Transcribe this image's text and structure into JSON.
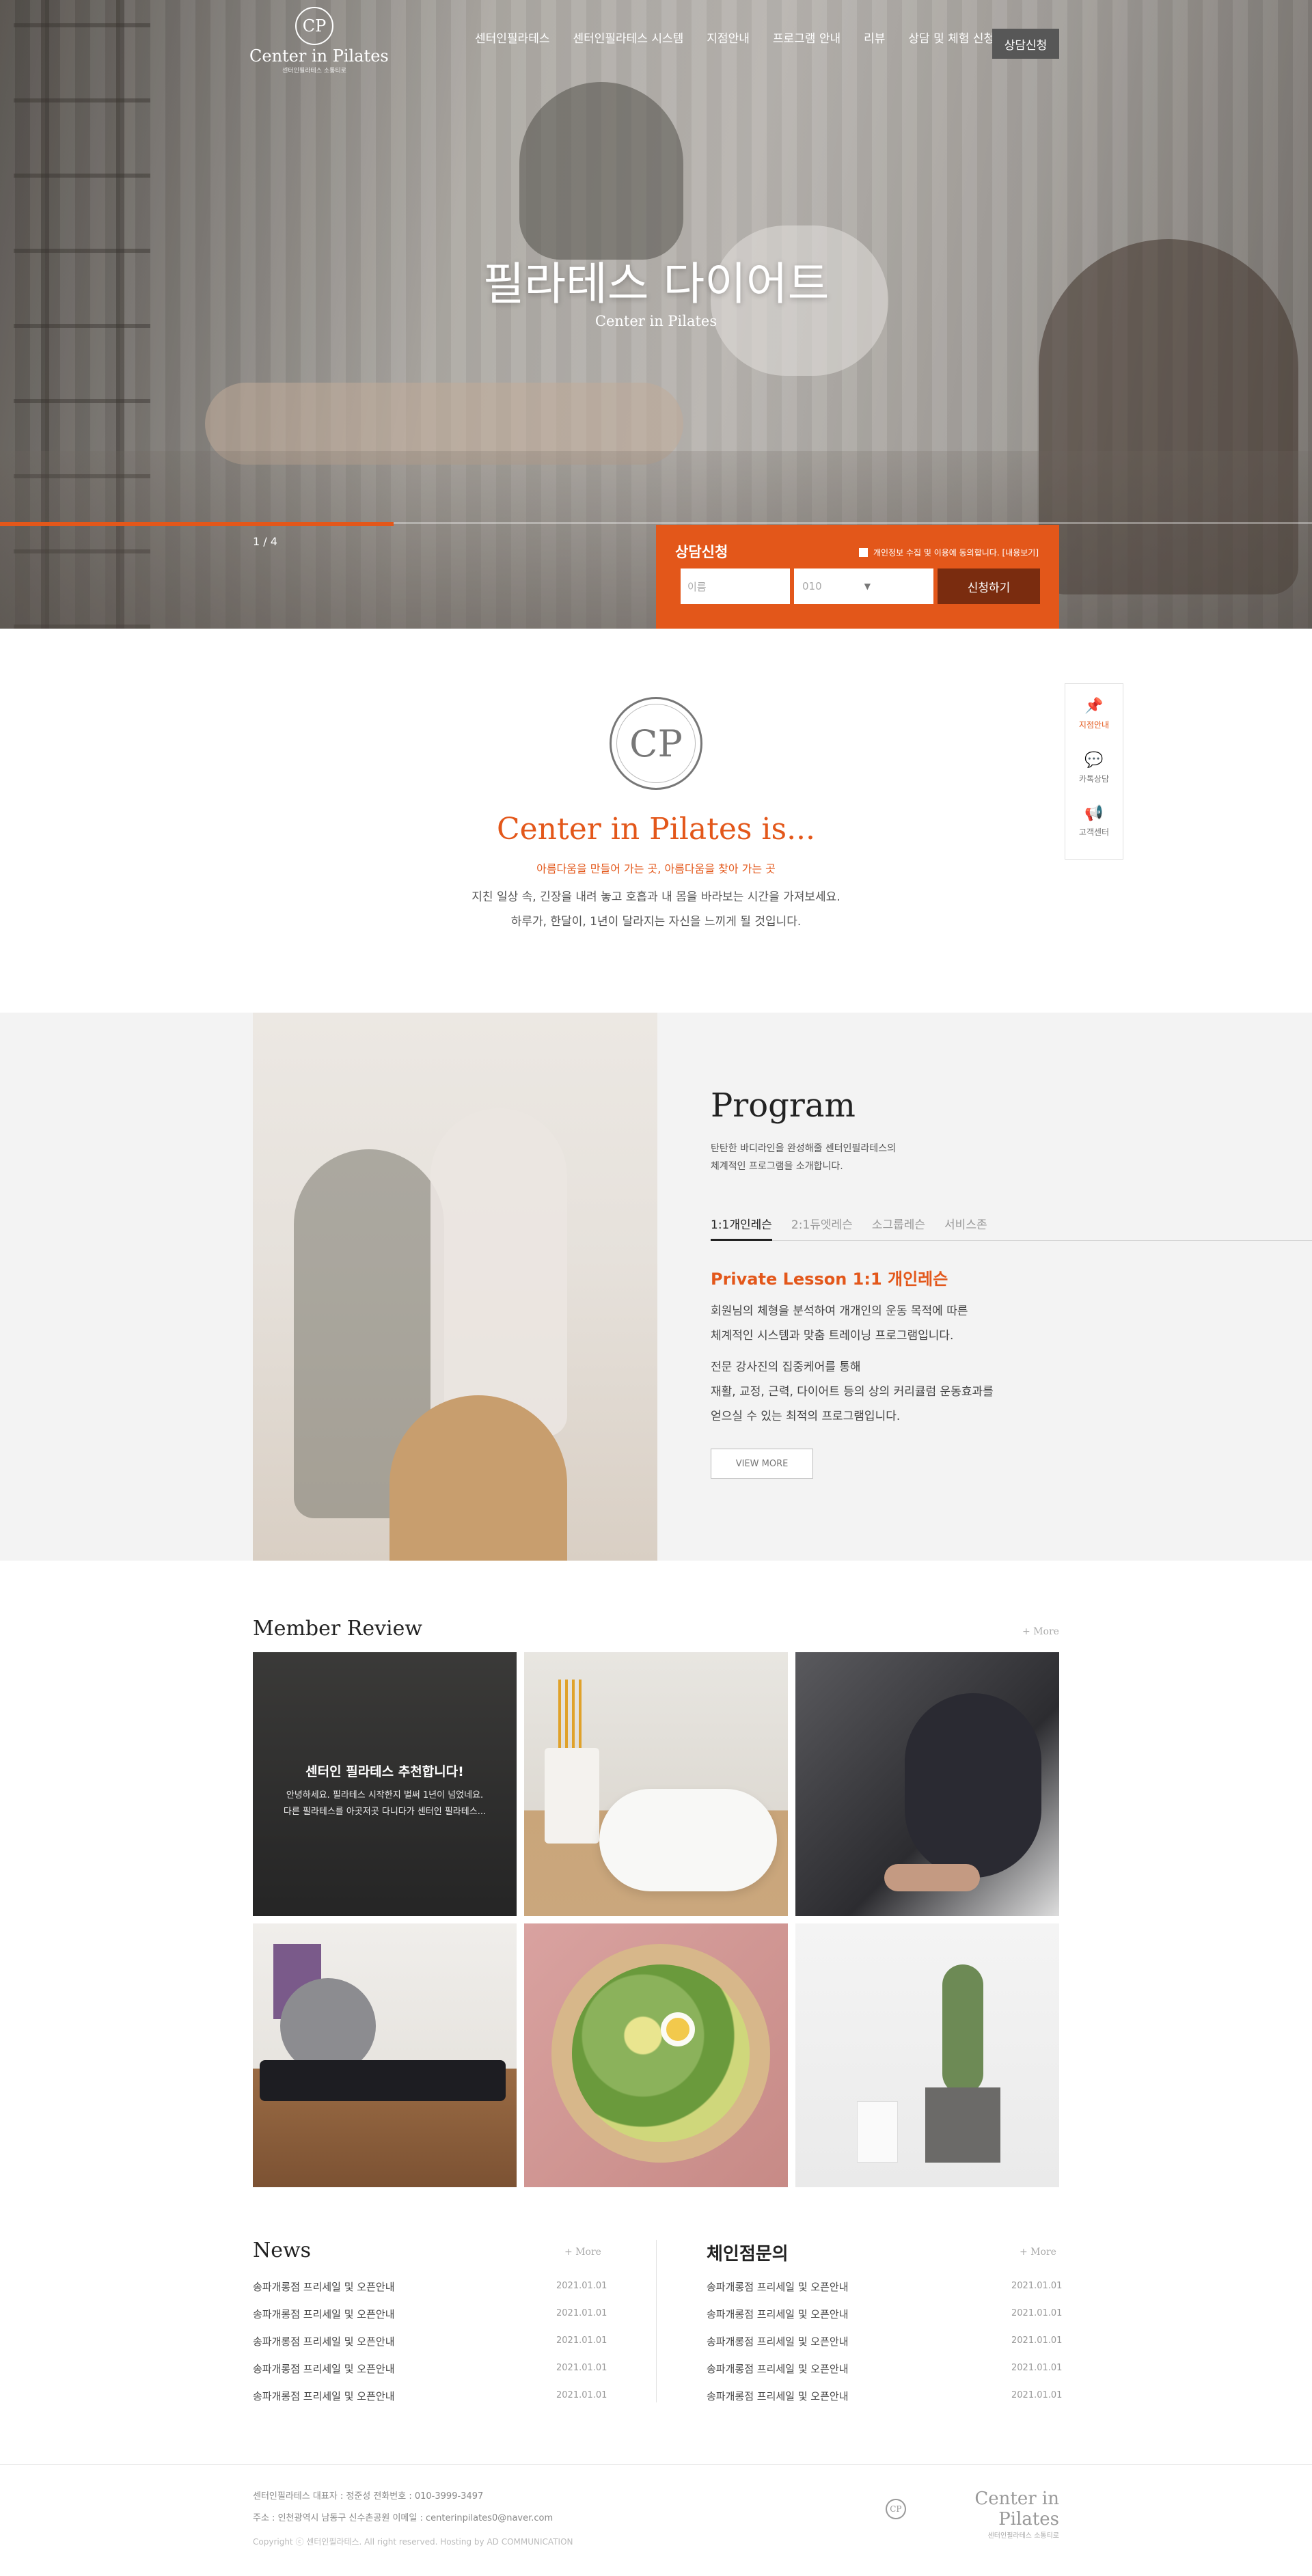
{
  "header": {
    "logo_mark": "CP",
    "logo_name": "Center in Pilates",
    "logo_sub": "센터인필라테스 소통티로",
    "nav": [
      "센터인필라테스",
      "센터인필라테스 시스템",
      "지점안내",
      "프로그램 안내",
      "리뷰",
      "상담 및 체험 신청"
    ],
    "cta": "상담신청"
  },
  "hero": {
    "title": "필라테스 다이어트",
    "subtitle": "Center in Pilates",
    "pager": "1 / 4",
    "progress": 0.3
  },
  "consult": {
    "title": "상담신청",
    "agree": "개인정보 수집 및 이용에 동의합니다. [내용보기]",
    "name_placeholder": "이름",
    "phone_prefix": "010",
    "phone_arrow": "▼",
    "submit": "신청하기"
  },
  "quick": [
    {
      "icon": "pin-icon",
      "glyph": "📌",
      "label": "지점안내",
      "active": true
    },
    {
      "icon": "chat-icon",
      "glyph": "💬",
      "label": "카톡상담",
      "active": false
    },
    {
      "icon": "megaphone-icon",
      "glyph": "📢",
      "label": "고객센터",
      "active": false
    }
  ],
  "intro": {
    "mark": "CP",
    "title": "Center in Pilates is...",
    "subtitle": "아름다움을 만들어 가는 곳, 아름다움을 찾아 가는 곳",
    "lines": [
      "지친 일상 속, 긴장을 내려 놓고 호흡과 내 몸을 바라보는 시간을 가져보세요.",
      "하루가, 한달이, 1년이 달라지는 자신을 느끼게 될 것입니다."
    ]
  },
  "program": {
    "title": "Program",
    "desc": [
      "탄탄한 바디라인을 완성해줄 센터인필라테스의",
      "체계적인 프로그램을 소개합니다."
    ],
    "tabs": [
      "1:1개인레슨",
      "2:1듀엣레슨",
      "소그룹레슨",
      "서비스존"
    ],
    "heading": "Private Lesson 1:1 개인레슨",
    "para1": [
      "회원님의 체형을 분석하여 개개인의 운동 목적에 따른",
      "체계적인 시스템과 맞춤 트레이닝 프로그램입니다."
    ],
    "para2": [
      "전문 강사진의 집중케어를 통해",
      "재활, 교정, 근력, 다이어트 등의 상의 커리큘럼 운동효과를",
      "얻으실 수 있는 최적의 프로그램입니다."
    ],
    "view_more": "VIEW MORE"
  },
  "review": {
    "title": "Member Review",
    "more": "+ More",
    "card_title": "센터인 필라테스 추천합니다!",
    "card_lines": [
      "안녕하세요. 필라테스 시작한지 벌써 1년이 넘었네요.",
      "다른 필라테스를 아곳저곳 다니다가 센터인 필라테스..."
    ]
  },
  "news": {
    "title": "News",
    "more": "+ More",
    "items": [
      {
        "text": "송파개롱점 프리세일 및 오픈안내",
        "date": "2021.01.01"
      },
      {
        "text": "송파개롱점 프리세일 및 오픈안내",
        "date": "2021.01.01"
      },
      {
        "text": "송파개롱점 프리세일 및 오픈안내",
        "date": "2021.01.01"
      },
      {
        "text": "송파개롱점 프리세일 및 오픈안내",
        "date": "2021.01.01"
      },
      {
        "text": "송파개롱점 프리세일 및 오픈안내",
        "date": "2021.01.01"
      }
    ]
  },
  "franchise": {
    "title": "체인점문의",
    "more": "+ More",
    "items": [
      {
        "text": "송파개롱점 프리세일 및 오픈안내",
        "date": "2021.01.01"
      },
      {
        "text": "송파개롱점 프리세일 및 오픈안내",
        "date": "2021.01.01"
      },
      {
        "text": "송파개롱점 프리세일 및 오픈안내",
        "date": "2021.01.01"
      },
      {
        "text": "송파개롱점 프리세일 및 오픈안내",
        "date": "2021.01.01"
      },
      {
        "text": "송파개롱점 프리세일 및 오픈안내",
        "date": "2021.01.01"
      }
    ]
  },
  "footer": {
    "line1": "센터인필라테스     대표자 : 정준성     전화번호 : 010-3999-3497",
    "line2": "주소 : 인천광역시 남동구 신수촌공원     이메일 : centerinpilates0@naver.com",
    "copy": "Copyright ⓒ 센터인필라테스. All right reserved. Hosting by AD COMMUNICATION",
    "logo_mark": "CP",
    "logo_name": "Center in Pilates",
    "logo_sub": "센터인필라테스 소통티로"
  },
  "colors": {
    "accent": "#e3571a",
    "dark_button": "#7a2c0f",
    "gray_button": "#575757"
  }
}
